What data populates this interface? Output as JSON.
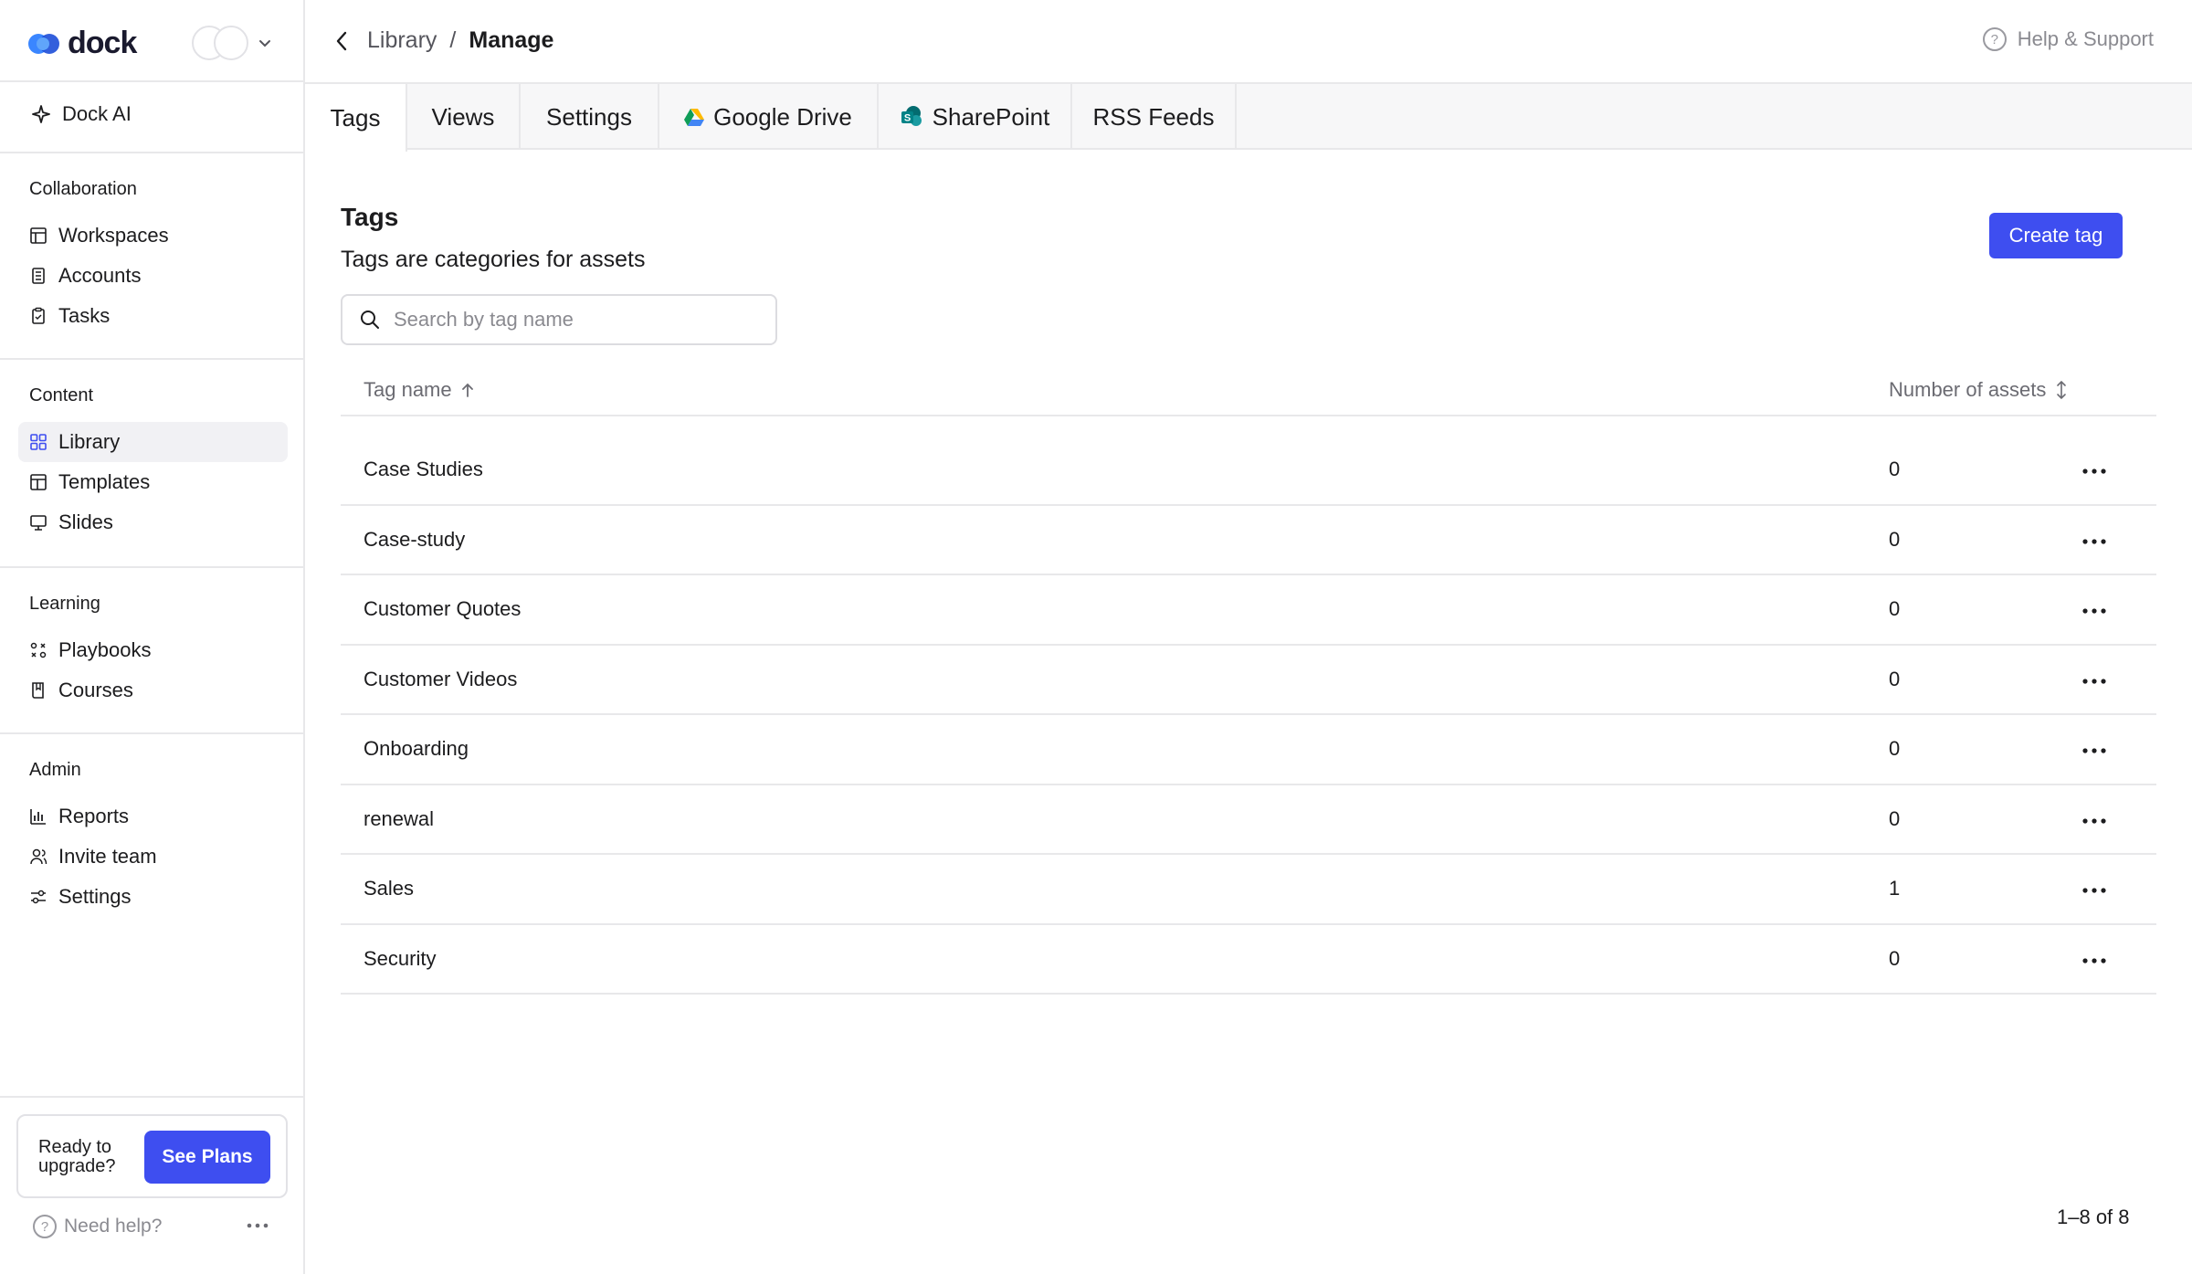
{
  "brand": {
    "name": "dock",
    "accent": "#3e4ef0"
  },
  "sidebar": {
    "dock_ai": "Dock AI",
    "sections": [
      {
        "title": "Collaboration",
        "items": [
          {
            "label": "Workspaces",
            "icon": "workspaces-icon"
          },
          {
            "label": "Accounts",
            "icon": "accounts-icon"
          },
          {
            "label": "Tasks",
            "icon": "tasks-icon"
          }
        ]
      },
      {
        "title": "Content",
        "items": [
          {
            "label": "Library",
            "icon": "library-icon",
            "active": true
          },
          {
            "label": "Templates",
            "icon": "templates-icon"
          },
          {
            "label": "Slides",
            "icon": "slides-icon"
          }
        ]
      },
      {
        "title": "Learning",
        "items": [
          {
            "label": "Playbooks",
            "icon": "playbooks-icon"
          },
          {
            "label": "Courses",
            "icon": "courses-icon"
          }
        ]
      },
      {
        "title": "Admin",
        "items": [
          {
            "label": "Reports",
            "icon": "reports-icon"
          },
          {
            "label": "Invite team",
            "icon": "invite-team-icon"
          },
          {
            "label": "Settings",
            "icon": "settings-icon"
          }
        ]
      }
    ],
    "upgrade": {
      "text": "Ready to upgrade?",
      "button": "See Plans"
    },
    "need_help": "Need help?"
  },
  "header": {
    "breadcrumb": {
      "parent": "Library",
      "separator": "/",
      "current": "Manage"
    },
    "help": "Help & Support"
  },
  "tabs": [
    {
      "label": "Tags",
      "active": true
    },
    {
      "label": "Views"
    },
    {
      "label": "Settings"
    },
    {
      "label": "Google Drive",
      "icon": "google-drive-icon"
    },
    {
      "label": "SharePoint",
      "icon": "sharepoint-icon"
    },
    {
      "label": "RSS Feeds"
    }
  ],
  "main": {
    "title": "Tags",
    "subtitle": "Tags are categories for assets",
    "create_button": "Create tag",
    "search": {
      "placeholder": "Search by tag name",
      "value": ""
    },
    "table": {
      "columns": [
        "Tag name",
        "Number of assets"
      ],
      "rows": [
        {
          "name": "Case Studies",
          "count": "0"
        },
        {
          "name": "Case-study",
          "count": "0"
        },
        {
          "name": "Customer Quotes",
          "count": "0"
        },
        {
          "name": "Customer Videos",
          "count": "0"
        },
        {
          "name": "Onboarding",
          "count": "0"
        },
        {
          "name": "renewal",
          "count": "0"
        },
        {
          "name": "Sales",
          "count": "1"
        },
        {
          "name": "Security",
          "count": "0"
        }
      ]
    },
    "pagination": "1–8 of 8"
  }
}
